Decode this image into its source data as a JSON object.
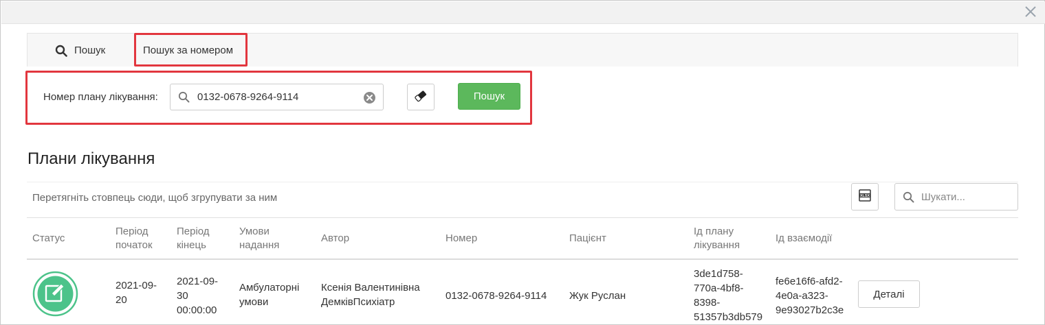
{
  "tabs": {
    "search_label": "Пошук",
    "by_number_label": "Пошук за номером"
  },
  "form": {
    "label": "Номер плану лікування:",
    "value": "0132-0678-9264-9114",
    "submit_label": "Пошук"
  },
  "section": {
    "title": "Плани лікування"
  },
  "grid": {
    "group_hint": "Перетягніть стовпець сюди, щоб згрупувати за ним",
    "search_placeholder": "Шукати...",
    "columns": [
      {
        "line1": "Статус",
        "line2": "",
        "line3": ""
      },
      {
        "line1": "Період",
        "line2": "початок",
        "line3": ""
      },
      {
        "line1": "Період",
        "line2": "кінець",
        "line3": ""
      },
      {
        "line1": "Умови",
        "line2": "надання",
        "line3": ""
      },
      {
        "line1": "Автор",
        "line2": "",
        "line3": ""
      },
      {
        "line1": "Номер",
        "line2": "",
        "line3": ""
      },
      {
        "line1": "Пацієнт",
        "line2": "",
        "line3": ""
      },
      {
        "line1": "Ід плану",
        "line2": "лікування",
        "line3": ""
      },
      {
        "line1": "Ід взаємодії",
        "line2": "",
        "line3": ""
      }
    ],
    "rows": [
      {
        "status_icon": "edit-document-icon",
        "period_start": [
          "2021-09-",
          "20"
        ],
        "period_end": [
          "2021-09-",
          "30",
          "00:00:00"
        ],
        "conditions": [
          "Амбулаторні",
          "умови"
        ],
        "author": [
          "Ксенія Валентинівна",
          "ДемківПсихіатр"
        ],
        "number": "0132-0678-9264-9114",
        "patient": "Жук Руслан",
        "plan_id": [
          "3de1d758-",
          "770a-4bf8-",
          "8398-",
          "51357b3db579"
        ],
        "interaction_id": [
          "fe6e16f6-afd2-",
          "4e0a-a323-",
          "9e93027b2c3e"
        ],
        "details_label": "Деталі"
      }
    ]
  },
  "colors": {
    "highlight": "#e2363e",
    "success": "#5cb85c",
    "status_green": "#4cc38a"
  }
}
